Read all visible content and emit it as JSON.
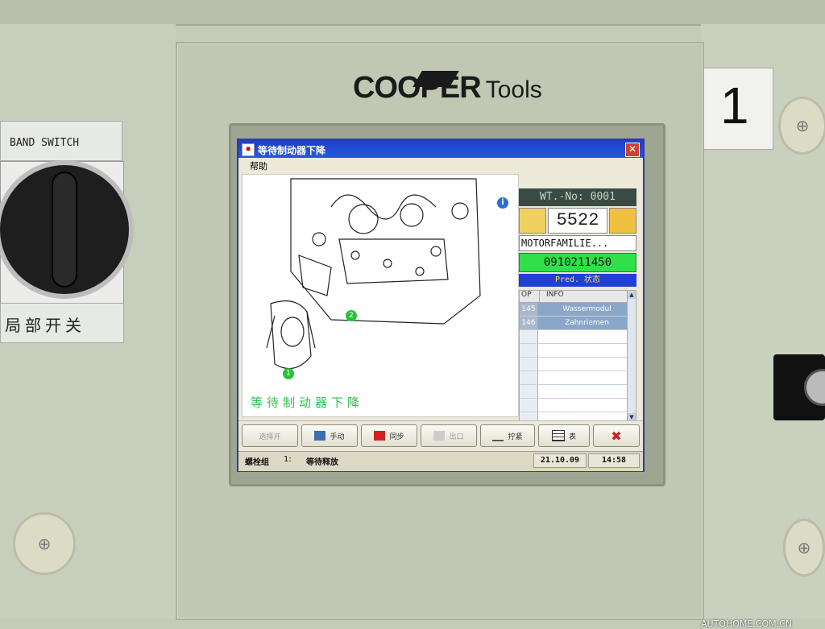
{
  "watermark": "汽车之家 AUTOHOME.COM.CN",
  "hardware": {
    "band_switch_label": "BAND SWITCH",
    "local_switch_label": "局部开关",
    "station_number": "1",
    "brand_name": "COOPER",
    "brand_suffix": "Tools"
  },
  "window": {
    "title": "等待制动器下降",
    "close_glyph": "✕",
    "menu": {
      "help": "帮助"
    }
  },
  "diagram": {
    "caption": "等待制动器下降",
    "callouts": [
      "1",
      "2"
    ],
    "info_glyph": "i"
  },
  "panel": {
    "wt_no": "WT.-No: 0001",
    "cycle_number": "5522",
    "motor_family": "MOTORFAMILIE...",
    "serial": "0910211450",
    "status_text": "Pred. 状态",
    "table": {
      "headers": [
        "OP",
        "INFO"
      ],
      "rows": [
        {
          "op": "145",
          "info": "Wassermodul"
        },
        {
          "op": "146",
          "info": "Zahnriemen"
        },
        {
          "op": "",
          "info": ""
        },
        {
          "op": "",
          "info": ""
        },
        {
          "op": "",
          "info": ""
        },
        {
          "op": "",
          "info": ""
        },
        {
          "op": "",
          "info": ""
        },
        {
          "op": "",
          "info": ""
        },
        {
          "op": "",
          "info": ""
        }
      ]
    }
  },
  "buttons": [
    {
      "label": "选择开",
      "enabled": false
    },
    {
      "label": "手动",
      "enabled": true
    },
    {
      "label": "同步",
      "enabled": true
    },
    {
      "label": "出口",
      "enabled": false
    },
    {
      "label": "拧紧",
      "enabled": true
    },
    {
      "label": "表",
      "enabled": true
    },
    {
      "label": "✖",
      "enabled": true
    }
  ],
  "statusbar": {
    "group_label": "螺栓组",
    "group_number": "1:",
    "message": "等待释放",
    "date": "21.10.09",
    "time": "14:58"
  },
  "colors": {
    "titlebar": "#1b3fc6",
    "serial_bg": "#2fe048",
    "status_bg": "#1f3fd6",
    "caption": "#2fbf48",
    "close_button": "#d04030"
  }
}
